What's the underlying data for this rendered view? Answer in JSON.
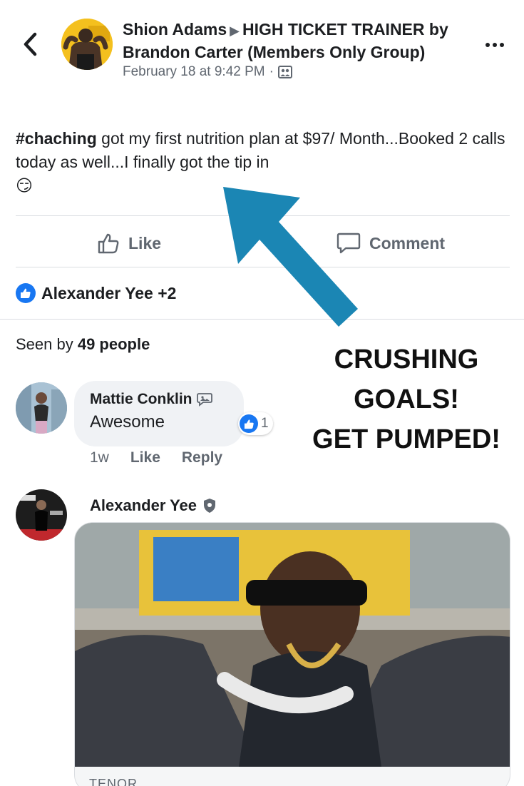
{
  "header": {
    "author": "Shion Adams",
    "group": "HIGH TICKET TRAINER by Brandon Carter (Members Only Group)",
    "timestamp": "February 18 at 9:42 PM",
    "separator": "·",
    "back_icon": "back-chevron-icon",
    "more_icon": "more-dots-icon"
  },
  "post": {
    "hashtag": "#chaching",
    "text": " got my first nutrition plan at $97/ Month...Booked 2 calls today as well...I finally got the tip in",
    "emoji": "😏"
  },
  "actions": {
    "like_label": "Like",
    "comment_label": "Comment"
  },
  "reactions": {
    "summary": "Alexander Yee +2"
  },
  "seen_by": {
    "prefix": "Seen by ",
    "count_text": "49 people"
  },
  "comments": [
    {
      "author": "Mattie Conklin",
      "text": "Awesome",
      "age": "1w",
      "like_label": "Like",
      "reply_label": "Reply",
      "reaction_count": "1"
    },
    {
      "author": "Alexander Yee",
      "gif_source": "TENOR"
    }
  ],
  "overlay": {
    "line1": "CRUSHING",
    "line2": "GOALS!",
    "line3": "GET PUMPED!",
    "arrow_color": "#1b86b4"
  },
  "colors": {
    "facebook_blue": "#1877f2",
    "secondary_text": "#606770"
  }
}
